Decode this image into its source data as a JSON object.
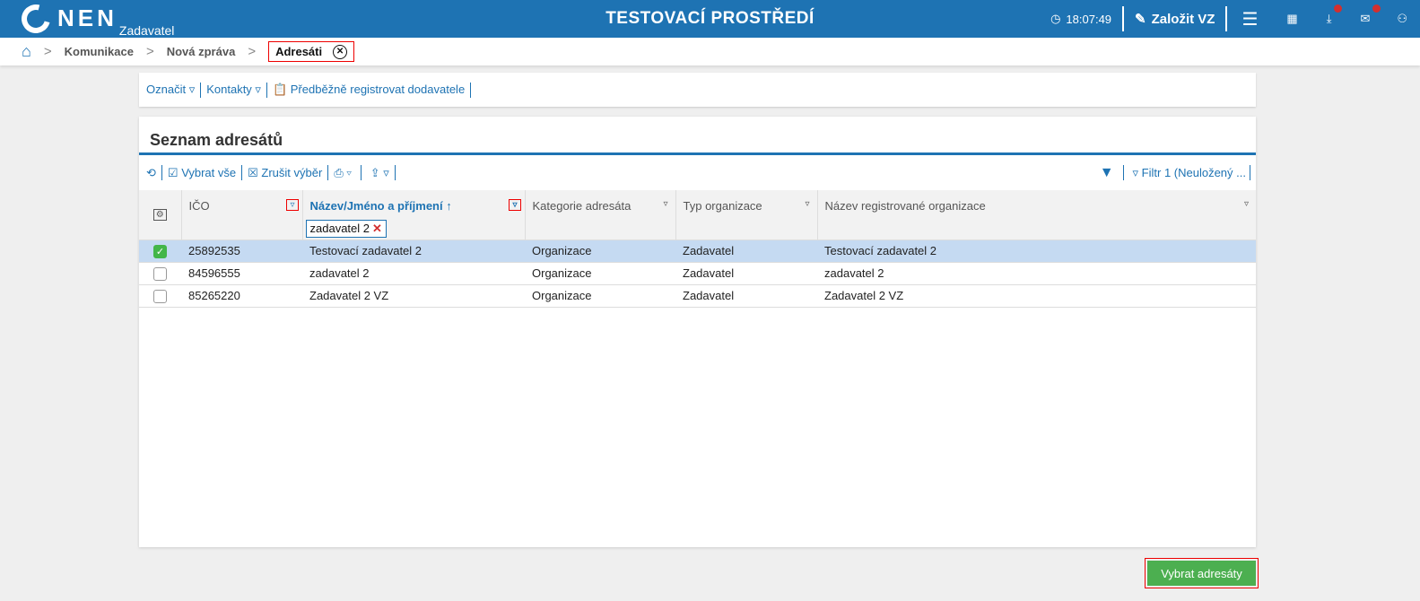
{
  "header": {
    "logo": "NEN",
    "logo_sub": "Zadavatel",
    "title": "TESTOVACÍ PROSTŘEDÍ",
    "time": "18:07:49",
    "create_label": "Založit VZ"
  },
  "breadcrumb": [
    "Komunikace",
    "Nová zpráva",
    "Adresáti"
  ],
  "actions": {
    "mark": "Označit",
    "contacts": "Kontakty",
    "register": "Předběžně registrovat dodavatele"
  },
  "list": {
    "title": "Seznam adresátů",
    "select_all": "Vybrat vše",
    "deselect": "Zrušit výběr",
    "filter": "Filtr 1 (Neuložený ...",
    "columns": [
      "IČO",
      "Název/Jméno a příjmení",
      "Kategorie adresáta",
      "Typ organizace",
      "Název registrované organizace"
    ],
    "name_filter": "zadavatel 2",
    "rows": [
      {
        "ico": "25892535",
        "name": "Testovací zadavatel 2",
        "cat": "Organizace",
        "type": "Zadavatel",
        "reg": "Testovací zadavatel 2",
        "selected": true
      },
      {
        "ico": "84596555",
        "name": "zadavatel 2",
        "cat": "Organizace",
        "type": "Zadavatel",
        "reg": "zadavatel 2",
        "selected": false
      },
      {
        "ico": "85265220",
        "name": "Zadavatel 2 VZ",
        "cat": "Organizace",
        "type": "Zadavatel",
        "reg": "Zadavatel 2 VZ",
        "selected": false
      }
    ]
  },
  "submit": "Vybrat adresáty"
}
